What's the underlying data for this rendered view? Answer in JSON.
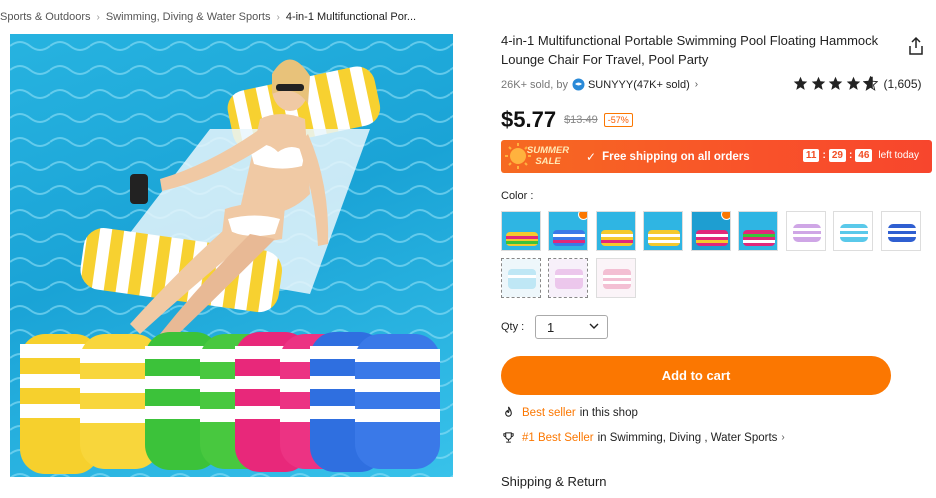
{
  "breadcrumb": {
    "items": [
      "Sports & Outdoors",
      "Swimming, Diving & Water Sports",
      "4-in-1 Multifunctional Por..."
    ]
  },
  "product": {
    "title": "4-in-1 Multifunctional Portable Swimming Pool Floating Hammock Lounge Chair For Travel, Pool Party",
    "sold": "26K+ sold, by",
    "seller": "SUNYYY(47K+ sold)",
    "rating_stars": 4.5,
    "rating_count": "(1,605)",
    "price": "$5.77",
    "original_price": "$13.49",
    "discount": "-57%"
  },
  "promo": {
    "badge_line1": "SUMMER",
    "badge_line2": "SALE",
    "text": "Free shipping on all orders",
    "hours": "11",
    "minutes": "29",
    "seconds": "46",
    "suffix": "left today"
  },
  "options": {
    "color_label": "Color :",
    "swatches": [
      {
        "name": "multicolor-1",
        "hot": false
      },
      {
        "name": "multicolor-2",
        "hot": true
      },
      {
        "name": "multicolor-3",
        "hot": false
      },
      {
        "name": "multicolor-4",
        "hot": false
      },
      {
        "name": "multicolor-5",
        "hot": true
      },
      {
        "name": "multicolor-6",
        "hot": false
      },
      {
        "name": "purple",
        "hot": false
      },
      {
        "name": "blue",
        "hot": false
      },
      {
        "name": "navy",
        "hot": false
      },
      {
        "name": "light-blue-set",
        "hot": false
      },
      {
        "name": "pink-set",
        "hot": false
      },
      {
        "name": "pink-stripe-set",
        "hot": false
      }
    ],
    "qty_label": "Qty :",
    "qty_value": "1"
  },
  "actions": {
    "add_to_cart": "Add to cart"
  },
  "badges": {
    "best_seller_hl": "Best seller",
    "best_seller_rest": "in this shop",
    "rank_hl": "#1 Best Seller",
    "rank_rest": "in Swimming, Diving , Water Sports"
  },
  "shipping": {
    "title": "Shipping & Return"
  },
  "colors": {
    "accent": "#fb7701",
    "promo": "#f65a26"
  }
}
